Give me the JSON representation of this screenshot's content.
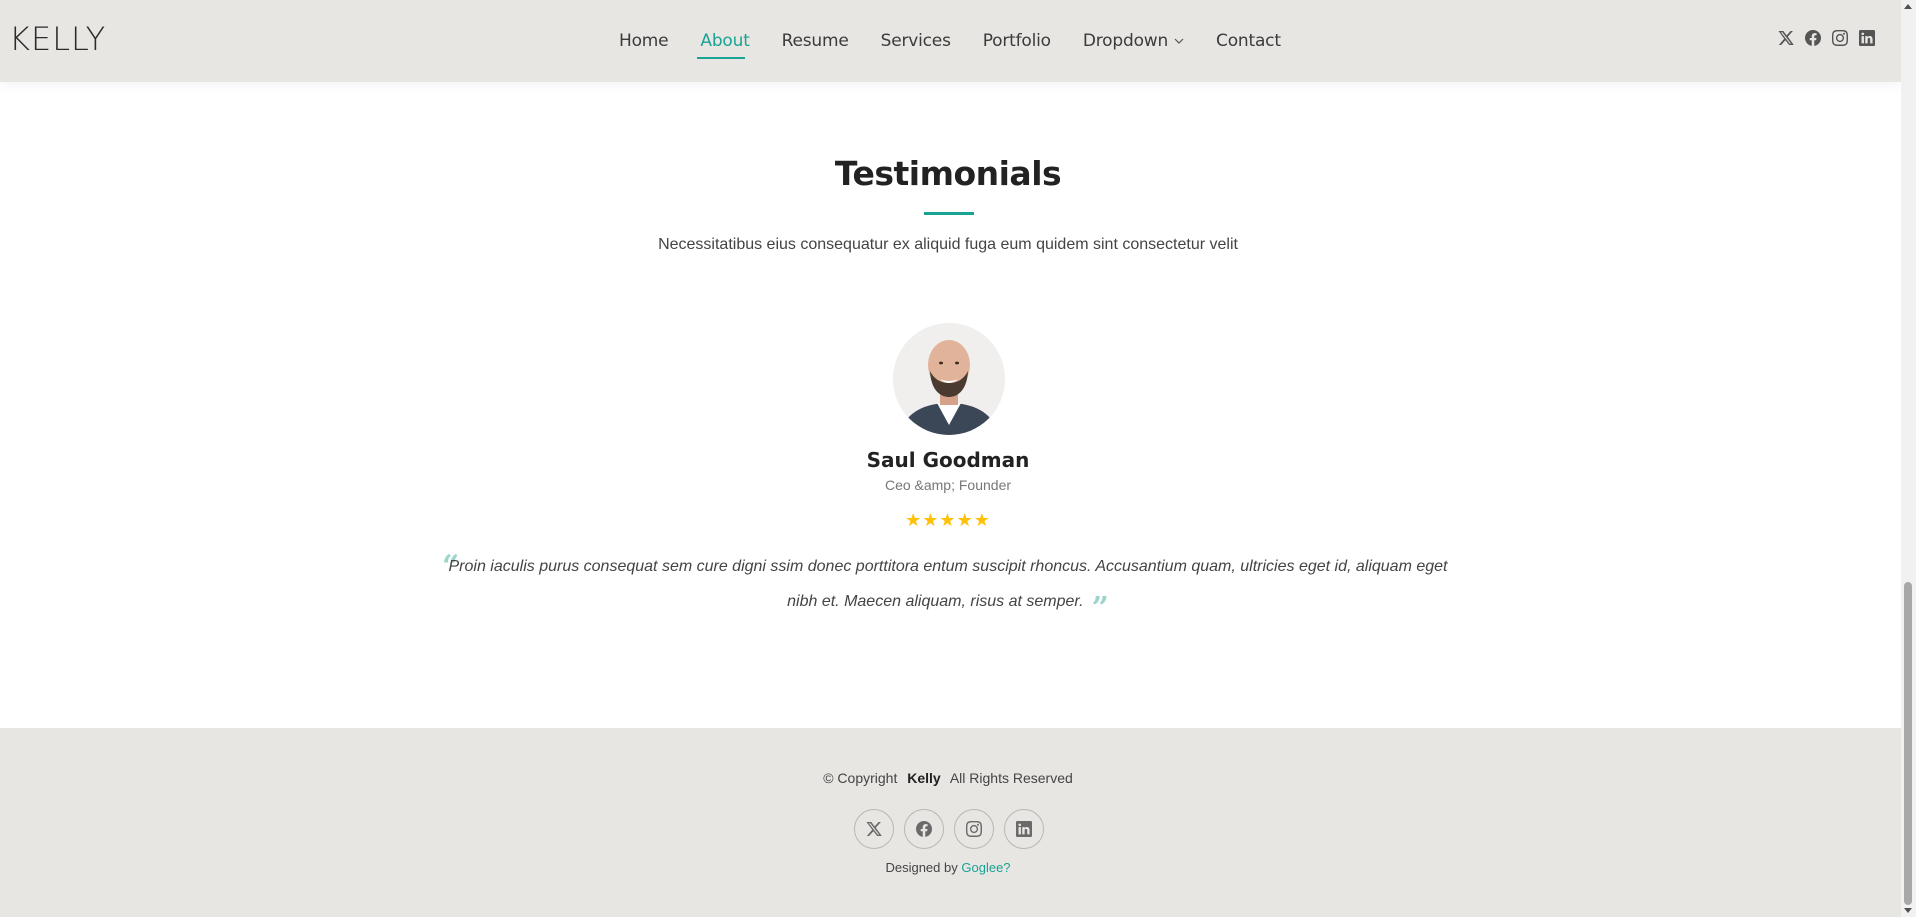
{
  "header": {
    "logo": "KELLY",
    "nav": [
      {
        "label": "Home",
        "active": false
      },
      {
        "label": "About",
        "active": true
      },
      {
        "label": "Resume",
        "active": false
      },
      {
        "label": "Services",
        "active": false
      },
      {
        "label": "Portfolio",
        "active": false
      },
      {
        "label": "Dropdown",
        "active": false,
        "has_dropdown": true
      },
      {
        "label": "Contact",
        "active": false
      }
    ],
    "social_icons": [
      "x-icon",
      "facebook-icon",
      "instagram-icon",
      "linkedin-icon"
    ]
  },
  "section": {
    "title": "Testimonials",
    "description": "Necessitatibus eius consequatur ex aliquid fuga eum quidem sint consectetur velit"
  },
  "testimonial": {
    "name": "Saul Goodman",
    "role": "Ceo &amp; Founder",
    "rating": 5,
    "stars": "★★★★★",
    "quote": "Proin iaculis purus consequat sem cure digni ssim donec porttitora entum suscipit rhoncus. Accusantium quam, ultricies eget id, aliquam eget nibh et. Maecen aliquam, risus at semper."
  },
  "footer": {
    "copyright_prefix": "© Copyright",
    "brand": "Kelly",
    "rights": "All Rights Reserved",
    "designed_by": "Designed by",
    "designer": "Goglee?",
    "social_icons": [
      "x-icon",
      "facebook-icon",
      "instagram-icon",
      "linkedin-icon"
    ]
  },
  "colors": {
    "accent": "#19a394",
    "header_bg": "#e8e6e3",
    "star": "#ffc107"
  }
}
